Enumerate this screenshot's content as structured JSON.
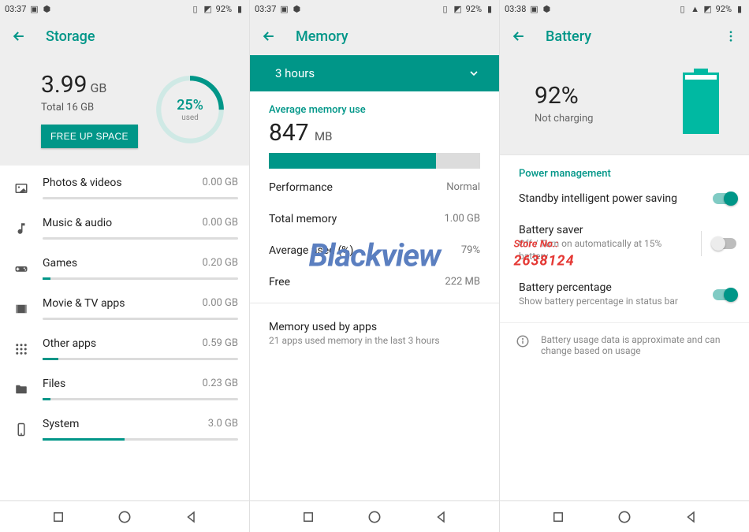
{
  "watermark": {
    "brand": "Blackview",
    "store_label": "Store No.:",
    "store_no": "2638124"
  },
  "pane_storage": {
    "status": {
      "time": "03:37",
      "battery_pct": "92%"
    },
    "title": "Storage",
    "hero": {
      "used_value": "3.99",
      "used_unit": "GB",
      "total": "Total 16 GB",
      "free_btn": "FREE UP SPACE",
      "ring_pct": "25%",
      "ring_label": "used",
      "ring_fill": 25
    },
    "items": [
      {
        "icon": "image-icon",
        "label": "Photos & videos",
        "value": "0.00 GB",
        "fill": 0
      },
      {
        "icon": "music-icon",
        "label": "Music & audio",
        "value": "0.00 GB",
        "fill": 0
      },
      {
        "icon": "gamepad-icon",
        "label": "Games",
        "value": "0.20 GB",
        "fill": 4
      },
      {
        "icon": "movie-icon",
        "label": "Movie & TV apps",
        "value": "0.00 GB",
        "fill": 0
      },
      {
        "icon": "apps-icon",
        "label": "Other apps",
        "value": "0.59 GB",
        "fill": 8
      },
      {
        "icon": "folder-icon",
        "label": "Files",
        "value": "0.23 GB",
        "fill": 4
      },
      {
        "icon": "system-icon",
        "label": "System",
        "value": "3.0 GB",
        "fill": 42
      }
    ]
  },
  "pane_memory": {
    "status": {
      "time": "03:37",
      "battery_pct": "92%"
    },
    "title": "Memory",
    "timespan": "3 hours",
    "avg_label": "Average memory use",
    "avg_value": "847",
    "avg_unit": "MB",
    "bar_fill": 79,
    "rows": [
      {
        "label": "Performance",
        "value": "Normal"
      },
      {
        "label": "Total memory",
        "value": "1.00 GB"
      },
      {
        "label": "Average used (%)",
        "value": "79%"
      },
      {
        "label": "Free",
        "value": "222 MB"
      }
    ],
    "apps": {
      "title": "Memory used by apps",
      "sub": "21 apps used memory in the last 3 hours"
    }
  },
  "pane_battery": {
    "status": {
      "time": "03:38",
      "battery_pct": "92%"
    },
    "title": "Battery",
    "hero": {
      "pct": "92%",
      "sub": "Not charging",
      "level": 92
    },
    "section": "Power management",
    "settings": [
      {
        "title": "Standby intelligent power saving",
        "sub": "",
        "on": true,
        "sep": false
      },
      {
        "title": "Battery saver",
        "sub": "Off / Turn on automatically at 15% battery",
        "on": false,
        "sep": true
      },
      {
        "title": "Battery percentage",
        "sub": "Show battery percentage in status bar",
        "on": true,
        "sep": false
      }
    ],
    "info": "Battery usage data is approximate and can change based on usage"
  }
}
